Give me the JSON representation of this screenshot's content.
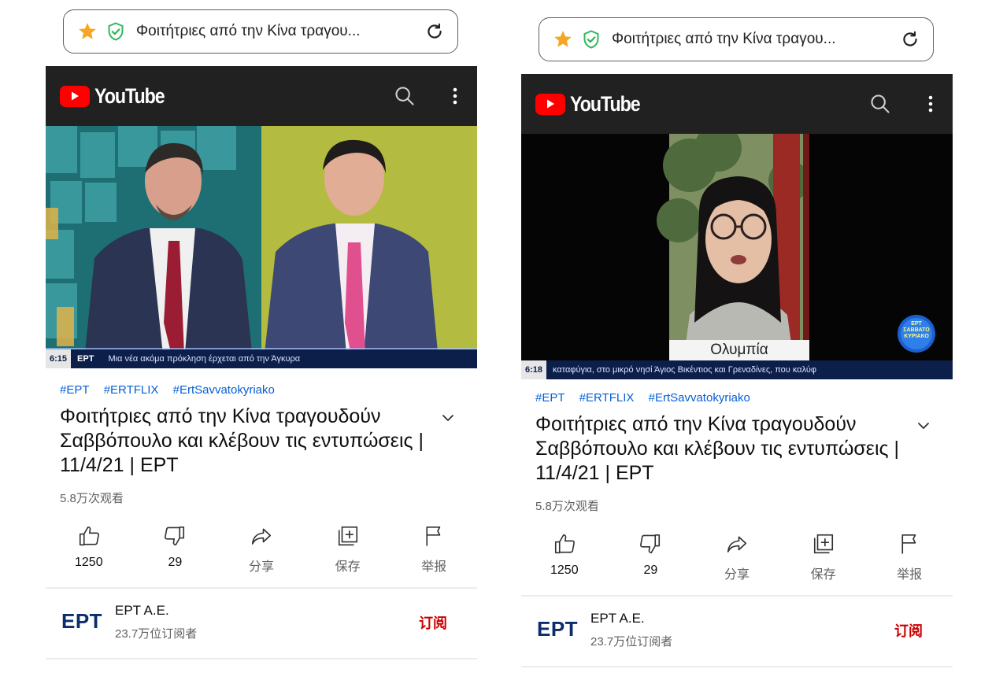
{
  "browser": {
    "tab_title": "Φοιτήτριες από την Κίνα τραγου..."
  },
  "youtube": {
    "brand": "YouTube"
  },
  "video": {
    "hashtags": [
      "#EPT",
      "#ERTFLIX",
      "#ErtSavvatokyriako"
    ],
    "title": "Φοιτήτριες από την Κίνα τραγουδούν Σαββόπουλο και κλέβουν τις εντυπώσεις | 11/4/21 | EPT",
    "views": "5.8万次观看"
  },
  "actions": [
    {
      "icon": "thumbs-up-icon",
      "label": "1250"
    },
    {
      "icon": "thumbs-down-icon",
      "label": "29"
    },
    {
      "icon": "share-icon",
      "label": "分享"
    },
    {
      "icon": "save-playlist-icon",
      "label": "保存"
    },
    {
      "icon": "flag-icon",
      "label": "举报"
    }
  ],
  "channel": {
    "logo_text": "EPT",
    "name": "EPT A.E.",
    "subscribers": "23.7万位订阅者",
    "subscribe_label": "订阅"
  },
  "frames": {
    "left": {
      "time": "6:15",
      "channel": "EPT",
      "ticker": "Μια νέα ακόμα πρόκληση έρχεται από την Άγκυρα"
    },
    "right": {
      "time": "6:18",
      "ticker": "καταφύγια, στο μικρό νησί Άγιος Βικέντιος και Γρεναδίνες, που καλύφ",
      "caption": "Ολυμπία",
      "badge_line1": "EPT",
      "badge_line2": "ΣΑΒΒΑΤΟ",
      "badge_line3": "ΚΥΡΙΑΚΟ"
    }
  },
  "colors": {
    "youtube_red": "#ff0000",
    "header_bg": "#212121",
    "hashtag_blue": "#065fd4",
    "subscribe_red": "#cc0000",
    "star_orange": "#f5a623",
    "shield_green": "#2fb85a"
  }
}
